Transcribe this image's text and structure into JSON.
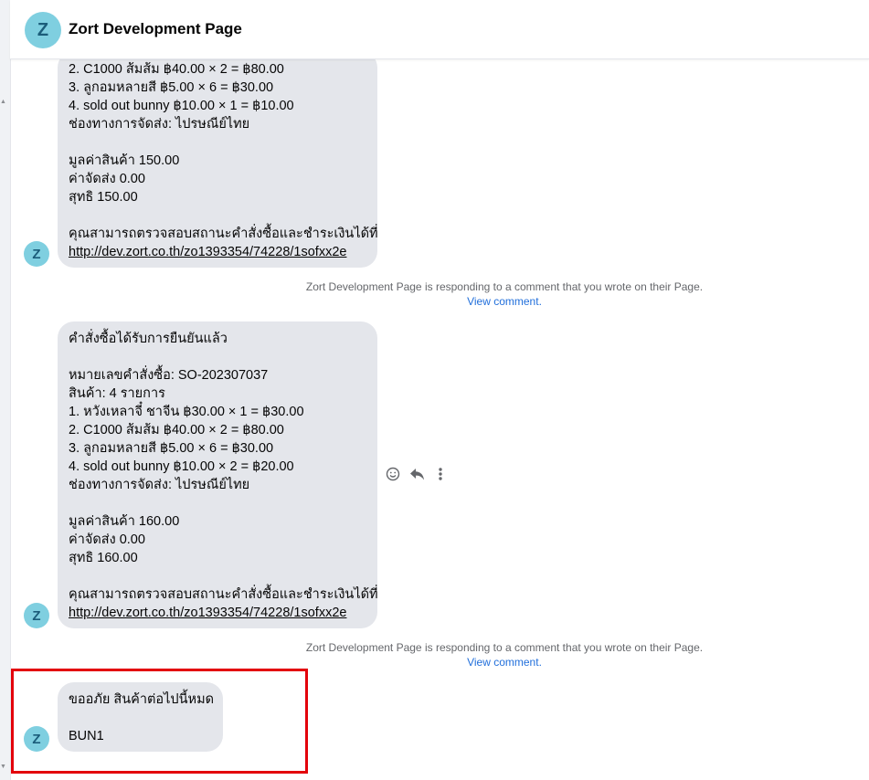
{
  "header": {
    "avatar_letter": "Z",
    "title": "Zort Development Page"
  },
  "messages": [
    {
      "avatar_letter": "Z",
      "lines": [
        "2. C1000 ส้มส้ม ฿40.00 × 2 = ฿80.00",
        "3. ลูกอมหลายสี ฿5.00 × 6 = ฿30.00",
        "4. sold out bunny ฿10.00 × 1 = ฿10.00",
        "ช่องทางการจัดส่ง: ไปรษณีย์ไทย",
        "",
        "มูลค่าสินค้า 150.00",
        "ค่าจัดส่ง 0.00",
        "สุทธิ 150.00",
        "",
        "คุณสามารถตรวจสอบสถานะคำสั่งซื้อและชำระเงินได้ที่"
      ],
      "link": "http://dev.zort.co.th/zo1393354/74228/1sofxx2e"
    },
    {
      "avatar_letter": "Z",
      "lines": [
        "คำสั่งซื้อได้รับการยืนยันแล้ว",
        "",
        "หมายเลขคำสั่งซื้อ: SO-202307037",
        "สินค้า: 4 รายการ",
        "1. หวังเหลาจี๋ ชาจีน ฿30.00 × 1 = ฿30.00",
        "2. C1000 ส้มส้ม ฿40.00 × 2 = ฿80.00",
        "3. ลูกอมหลายสี ฿5.00 × 6 = ฿30.00",
        "4. sold out bunny ฿10.00 × 2 = ฿20.00",
        "ช่องทางการจัดส่ง: ไปรษณีย์ไทย",
        "",
        "มูลค่าสินค้า 160.00",
        "ค่าจัดส่ง 0.00",
        "สุทธิ 160.00",
        "",
        "คุณสามารถตรวจสอบสถานะคำสั่งซื้อและชำระเงินได้ที่"
      ],
      "link": "http://dev.zort.co.th/zo1393354/74228/1sofxx2e"
    },
    {
      "avatar_letter": "Z",
      "lines": [
        "ขออภัย สินค้าต่อไปนี้หมด",
        "",
        "BUN1"
      ],
      "link": ""
    }
  ],
  "notices": [
    {
      "text": "Zort Development Page is responding to a comment that you wrote on their Page.",
      "link": "View comment."
    },
    {
      "text": "Zort Development Page is responding to a comment that you wrote on their Page.",
      "link": "View comment."
    }
  ],
  "actions": [
    {
      "icon": "emoji-icon"
    },
    {
      "icon": "reply-icon"
    },
    {
      "icon": "more-vertical-icon"
    }
  ],
  "colors": {
    "bubble": "#e4e6eb",
    "avatar": "#7fcfe0",
    "link": "#216fdb",
    "highlight": "#e3000b"
  }
}
